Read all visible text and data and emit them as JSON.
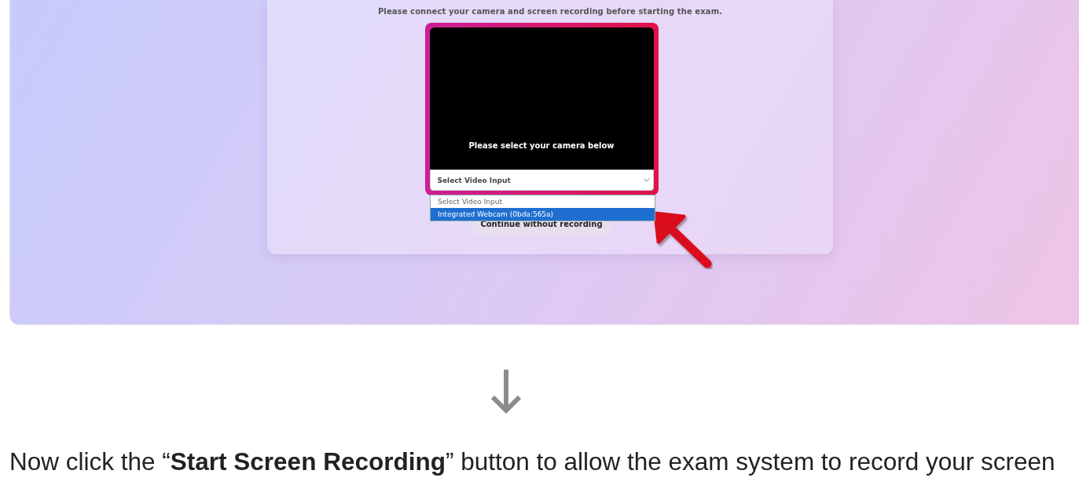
{
  "screenshot": {
    "card": {
      "instruction": "Please connect your camera and screen recording before starting the exam.",
      "camera": {
        "prompt": "Please select your camera below",
        "select": {
          "value": "Select Video Input",
          "expanded": true,
          "options": [
            {
              "label": "Select Video Input",
              "highlighted": false
            },
            {
              "label": "Integrated Webcam (0bda:565a)",
              "highlighted": true
            }
          ]
        }
      },
      "secondary_button": "Continue without recording"
    }
  },
  "caption": "Now click the “**Start Screen Recording**” button to allow the exam system to record your screen"
}
